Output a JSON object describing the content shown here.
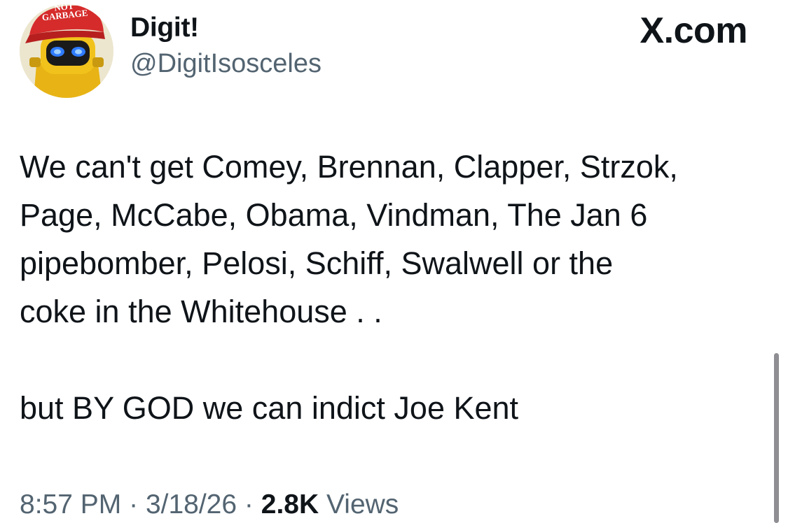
{
  "author": {
    "display_name": "Digit!",
    "handle": "@DigitIsosceles",
    "avatar": {
      "icon": "robot-avatar-icon",
      "hat_text": "NOT GARBAGE",
      "hat_color": "#d62b2b",
      "face_color": "#f1c21b",
      "eye_color": "#2f7bff"
    }
  },
  "brand": {
    "label": "X.com"
  },
  "tweet": {
    "paragraphs": [
      "We can't get Comey, Brennan, Clapper, Strzok,\nPage, McCabe, Obama, Vindman, The Jan 6\npipebomber, Pelosi, Schiff, Swalwell or the\ncoke in the Whitehouse . .",
      "but BY GOD we can indict Joe Kent"
    ]
  },
  "meta": {
    "time": "8:57 PM",
    "separator": "·",
    "date": "3/18/26",
    "views_count": "2.8K",
    "views_label": "Views"
  },
  "colors": {
    "text": "#0f1419",
    "secondary": "#536471",
    "background": "#ffffff"
  }
}
